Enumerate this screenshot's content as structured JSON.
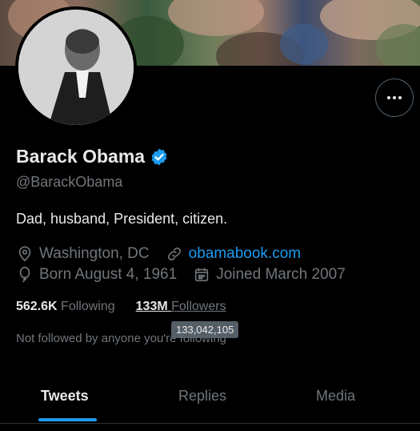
{
  "profile": {
    "name": "Barack Obama",
    "handle": "@BarackObama",
    "bio": "Dad, husband, President, citizen.",
    "location": "Washington, DC",
    "website": "obamabook.com",
    "birthday": "Born August 4, 1961",
    "joined": "Joined March 2007",
    "verified": true
  },
  "stats": {
    "following_count": "562.6K",
    "following_label": "Following",
    "followers_count": "133M",
    "followers_label": "Followers",
    "followers_tooltip": "133,042,105"
  },
  "not_followed_text": "Not followed by anyone you're following",
  "tabs": [
    {
      "label": "Tweets",
      "active": true
    },
    {
      "label": "Replies",
      "active": false
    },
    {
      "label": "Media",
      "active": false
    }
  ],
  "icons": {
    "location": "map-pin-icon",
    "link": "link-icon",
    "birthday": "balloon-icon",
    "joined": "calendar-icon",
    "verified": "verified-badge-icon",
    "more": "more-horizontal-icon"
  },
  "colors": {
    "background": "#000000",
    "text_primary": "#e7e9ea",
    "text_secondary": "#71767b",
    "accent": "#1d9bf0"
  }
}
